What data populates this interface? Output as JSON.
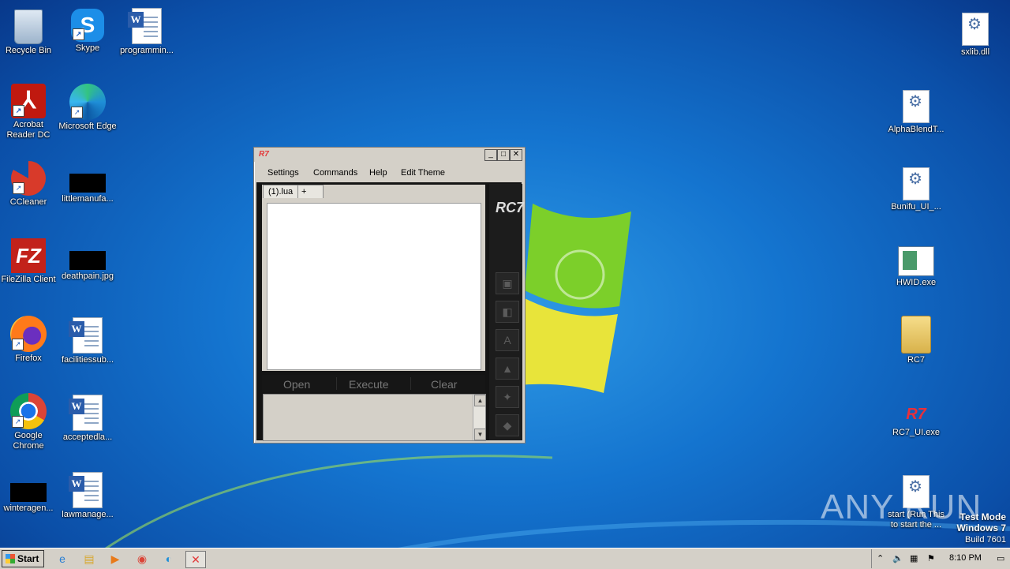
{
  "desktop": {
    "left_icons": [
      {
        "label": "Recycle Bin",
        "icon": "recycle-bin-icon"
      },
      {
        "label": "Skype",
        "icon": "skype-icon"
      },
      {
        "label": "programmin...",
        "icon": "word-document-icon"
      },
      {
        "label": "Acrobat Reader DC",
        "icon": "acrobat-icon"
      },
      {
        "label": "Microsoft Edge",
        "icon": "edge-icon"
      },
      {
        "label": "CCleaner",
        "icon": "ccleaner-icon"
      },
      {
        "label": "littlemanufa...",
        "icon": "black-file-icon"
      },
      {
        "label": "FileZilla Client",
        "icon": "filezilla-icon"
      },
      {
        "label": "deathpain.jpg",
        "icon": "black-image-icon"
      },
      {
        "label": "Firefox",
        "icon": "firefox-icon"
      },
      {
        "label": "facilitiessub...",
        "icon": "word-document-icon"
      },
      {
        "label": "Google Chrome",
        "icon": "chrome-icon"
      },
      {
        "label": "acceptedla...",
        "icon": "word-document-icon"
      },
      {
        "label": "winteragen...",
        "icon": "black-file-icon"
      },
      {
        "label": "lawmanage...",
        "icon": "word-document-icon"
      }
    ],
    "right_icons": [
      {
        "label": "sxlib.dll",
        "icon": "dll-gear-icon"
      },
      {
        "label": "AlphaBlendT...",
        "icon": "dll-gear-icon"
      },
      {
        "label": "Bunifu_UI_...",
        "icon": "dll-gear-icon"
      },
      {
        "label": "HWID.exe",
        "icon": "exe-window-icon"
      },
      {
        "label": "RC7",
        "icon": "folder-icon"
      },
      {
        "label": "RC7_UI.exe",
        "icon": "rc7-icon"
      },
      {
        "label": "start (Run This to start the ...",
        "icon": "dll-gear-icon"
      }
    ]
  },
  "window": {
    "title_logo": "R7",
    "menu": [
      "Settings",
      "Commands",
      "Help",
      "Edit Theme"
    ],
    "tabs": [
      "(1).lua",
      "+"
    ],
    "actions": [
      "Open",
      "Execute",
      "Clear"
    ],
    "sidebar_logo": "RC7",
    "sidebar_buttons": [
      "save-icon",
      "script-hub-icon",
      "attach-icon",
      "triangle-icon",
      "puzzle-icon",
      "fox-icon"
    ]
  },
  "taskbar": {
    "start_label": "Start",
    "pinned": [
      "internet-explorer-icon",
      "explorer-folder-icon",
      "media-player-icon",
      "chrome-icon",
      "edge-icon",
      "rc7-app-icon"
    ],
    "clock": "8:10 PM"
  },
  "watermark": {
    "line1": "Test Mode",
    "line2": "Windows 7",
    "line3": "Build 7601",
    "anyrun": "ANY RUN"
  },
  "colors": {
    "accent": "#e23a3a",
    "desktop": "#1474cf",
    "window_chrome": "#d4d0c8",
    "dark_panel": "#141414"
  }
}
